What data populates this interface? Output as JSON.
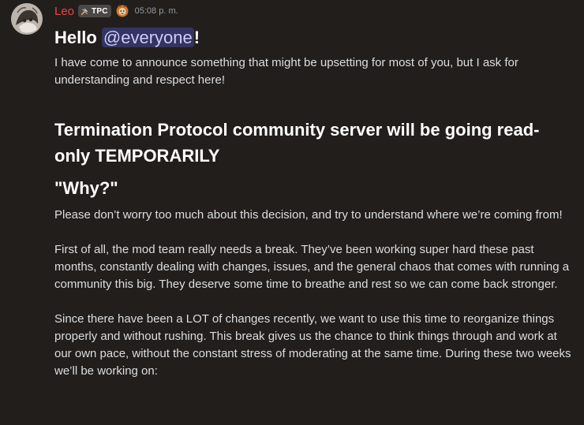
{
  "message": {
    "author": {
      "username": "Leo",
      "tag_label": "TPC",
      "tag_icon": "wrench-hammer-icon",
      "badge_icon": "lion-badge-icon",
      "name_color": "#ed4245"
    },
    "timestamp": "05:08 p. m.",
    "greeting_text": "Hello ",
    "mention": "@everyone",
    "greeting_suffix": "!",
    "intro": "I have come to announce something that might be upsetting for most of you, but I ask for understanding and respect here!",
    "heading_main": "Termination Protocol community server will be going read-only TEMPORARILY",
    "heading_why": "\"Why?\"",
    "paragraphs": [
      "Please don’t worry too much about this decision, and try to understand where we’re coming from!",
      "First of all, the mod team really needs a break. They’ve been working super hard these past months, constantly dealing with changes, issues, and the general chaos that comes with running a community this big. They deserve some time to breathe and rest so we can come back stronger.",
      "Since there have been a LOT of changes recently, we want to use this time to reorganize things properly and without rushing. This break gives us the chance to think things through and work at our own pace, without the constant stress of moderating at the same time. During these two weeks we’ll be working on:"
    ]
  },
  "colors": {
    "background": "#221e1b",
    "text": "#dbdee1",
    "heading": "#ffffff",
    "mention_bg": "#3b3f6e",
    "mention_text": "#c9cdfb",
    "timestamp": "#949ba4"
  }
}
